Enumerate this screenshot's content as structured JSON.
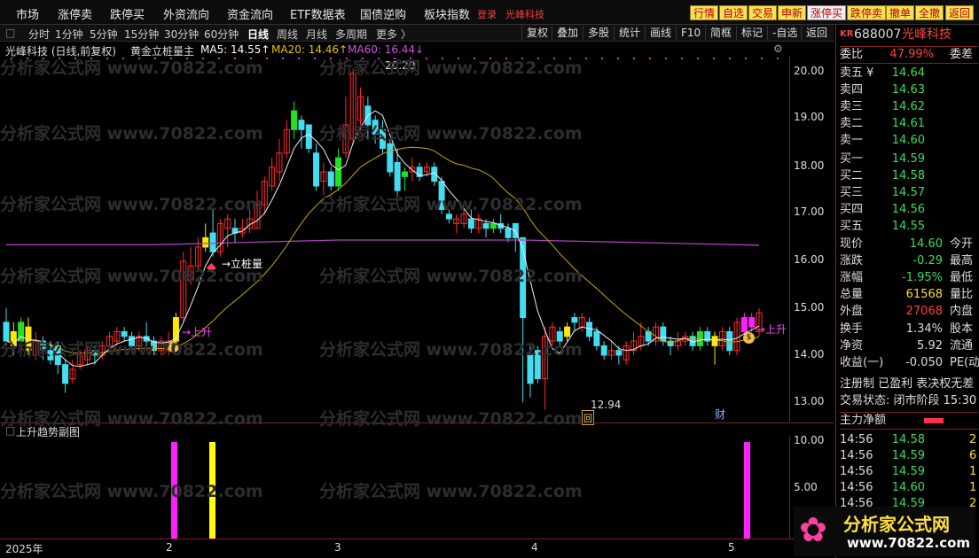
{
  "menu": {
    "items": [
      "市场",
      "涨停卖",
      "跌停买",
      "外资流向",
      "资金流向",
      "ETF数据表",
      "国债逆购",
      "板块指数"
    ],
    "login": "登录",
    "stock": "光峰科技"
  },
  "trade_buttons": [
    "行情",
    "自选",
    "交易",
    "申新",
    "涨停买",
    "跌停卖",
    "撤单",
    "全撤",
    "返回"
  ],
  "periods": [
    "分时",
    "1分钟",
    "5分钟",
    "15分钟",
    "30分钟",
    "60分钟",
    "日线",
    "周线",
    "月线",
    "多周期",
    "更多 〉"
  ],
  "active_period": "日线",
  "tools": [
    "复权",
    "叠加",
    "多股",
    "统计",
    "画线",
    "F10",
    "简框",
    "标记",
    "-自选",
    "返回"
  ],
  "info": {
    "name": "光峰科技 (日线,前复权)",
    "indicator": "黄金立桩量主",
    "ma5": "MA5: 14.55↑",
    "ma20": "MA20: 14.46↑",
    "ma60": "MA60: 16.44↓"
  },
  "annotations": {
    "high": "20.20",
    "low": "12.94",
    "libo": "→立桩量",
    "up1": "→上升",
    "up2": "→上升",
    "cai": "财",
    "hui": "回"
  },
  "y_ticks": [
    "20.00",
    "19.00",
    "18.00",
    "17.00",
    "16.00",
    "15.00",
    "14.00",
    "13.00"
  ],
  "sub": {
    "title": "上升趋势副图",
    "ticks": [
      "10.00",
      "5.00"
    ]
  },
  "dates": {
    "year": "2025年",
    "m2": "2",
    "m3": "3",
    "m4": "4",
    "m5": "5"
  },
  "watermark": "分析家公式网 www.70822.com",
  "panel": {
    "code": "688007",
    "name": "光峰科技",
    "kr": "KR",
    "weibi": {
      "label": "委比",
      "value": "47.99%",
      "extra": "委差"
    },
    "asks": [
      {
        "label": "卖五 ¥",
        "price": "14.64"
      },
      {
        "label": "卖四",
        "price": "14.63"
      },
      {
        "label": "卖三",
        "price": "14.62"
      },
      {
        "label": "卖二",
        "price": "14.61"
      },
      {
        "label": "卖一",
        "price": "14.60"
      }
    ],
    "bids": [
      {
        "label": "买一",
        "price": "14.59"
      },
      {
        "label": "买二",
        "price": "14.58"
      },
      {
        "label": "买三",
        "price": "14.57"
      },
      {
        "label": "买四",
        "price": "14.56"
      },
      {
        "label": "买五",
        "price": "14.55"
      }
    ],
    "stats": [
      {
        "label": "现价",
        "value": "14.60",
        "extra": "今开",
        "color": "#3ddc5c"
      },
      {
        "label": "涨跌",
        "value": "-0.29",
        "extra": "最高",
        "color": "#3ddc5c"
      },
      {
        "label": "涨幅",
        "value": "-1.95%",
        "extra": "最低",
        "color": "#3ddc5c"
      },
      {
        "label": "总量",
        "value": "61568",
        "extra": "量比",
        "color": "#ffdd33"
      },
      {
        "label": "外盘",
        "value": "27068",
        "extra": "内盘",
        "color": "#ff4040"
      },
      {
        "label": "换手",
        "value": "1.34%",
        "extra": "股本",
        "color": "#ddd"
      },
      {
        "label": "净资",
        "value": "5.92",
        "extra": "流通",
        "color": "#ddd"
      },
      {
        "label": "收益(一)",
        "value": "-0.050",
        "extra": "PE(动",
        "color": "#ddd"
      }
    ],
    "reg": "注册制 已盈利 表决权无差",
    "status": "交易状态: 闭市阶段 15:30",
    "mainflow": "主力净额",
    "ticks": [
      {
        "t": "14:56",
        "p": "14.58",
        "v": "2"
      },
      {
        "t": "14:56",
        "p": "14.59",
        "v": "6"
      },
      {
        "t": "14:56",
        "p": "14.59",
        "v": "1"
      },
      {
        "t": "14:56",
        "p": "14.60",
        "v": "1"
      },
      {
        "t": "14:56",
        "p": "14.59",
        "v": "2"
      }
    ]
  },
  "logo": {
    "text": "分析家公式网",
    "url": "www.70822.com"
  },
  "chart_data": {
    "type": "candlestick",
    "ylim": [
      12.8,
      20.3
    ],
    "candles": [
      [
        14.8,
        14.4,
        15.1,
        14.3
      ],
      [
        14.6,
        14.3,
        14.8,
        14.1
      ],
      [
        14.4,
        14.8,
        14.9,
        14.3
      ],
      [
        14.7,
        14.2,
        14.9,
        14.1
      ],
      [
        14.1,
        14.4,
        14.6,
        14.0
      ],
      [
        14.4,
        14.2,
        14.5,
        14.0
      ],
      [
        14.2,
        14.0,
        14.4,
        13.9
      ],
      [
        14.3,
        13.9,
        14.4,
        13.7
      ],
      [
        13.9,
        13.5,
        14.0,
        13.3
      ],
      [
        13.6,
        13.8,
        14.0,
        13.5
      ],
      [
        13.9,
        14.1,
        14.2,
        13.8
      ],
      [
        14.0,
        14.2,
        14.3,
        13.9
      ],
      [
        14.2,
        14.1,
        14.3,
        13.9
      ],
      [
        14.1,
        14.3,
        14.4,
        14.0
      ],
      [
        14.3,
        14.5,
        14.6,
        14.2
      ],
      [
        14.4,
        14.6,
        14.7,
        14.3
      ],
      [
        14.6,
        14.5,
        14.7,
        14.4
      ],
      [
        14.5,
        14.3,
        14.6,
        14.2
      ],
      [
        14.3,
        14.5,
        14.6,
        14.2
      ],
      [
        14.5,
        14.4,
        14.8,
        14.3
      ],
      [
        14.4,
        14.2,
        14.5,
        14.1
      ],
      [
        14.2,
        14.4,
        14.5,
        14.1
      ],
      [
        14.2,
        14.4,
        14.6,
        14.1
      ],
      [
        14.4,
        14.9,
        15.0,
        14.2
      ],
      [
        14.9,
        16.1,
        16.3,
        14.8
      ],
      [
        15.7,
        16.0,
        16.4,
        15.6
      ],
      [
        16.0,
        16.4,
        16.6,
        15.9
      ],
      [
        16.4,
        16.6,
        16.9,
        16.3
      ],
      [
        16.7,
        16.3,
        17.2,
        16.2
      ],
      [
        16.3,
        16.9,
        17.0,
        16.2
      ],
      [
        16.8,
        17.0,
        17.1,
        16.4
      ],
      [
        16.8,
        16.7,
        17.0,
        16.5
      ],
      [
        16.7,
        16.8,
        17.0,
        16.6
      ],
      [
        16.8,
        17.0,
        17.2,
        16.7
      ],
      [
        16.8,
        17.3,
        17.6,
        16.8
      ],
      [
        17.3,
        17.8,
        17.9,
        17.1
      ],
      [
        17.7,
        18.1,
        18.3,
        17.6
      ],
      [
        18.0,
        18.4,
        18.7,
        17.8
      ],
      [
        18.4,
        18.9,
        19.1,
        18.3
      ],
      [
        18.9,
        19.3,
        19.5,
        18.7
      ],
      [
        19.1,
        18.9,
        19.2,
        18.5
      ],
      [
        19.0,
        18.5,
        19.0,
        18.4
      ],
      [
        18.4,
        17.7,
        18.6,
        17.6
      ],
      [
        17.8,
        18.0,
        18.2,
        17.5
      ],
      [
        18.0,
        17.7,
        18.1,
        17.6
      ],
      [
        17.7,
        18.3,
        18.5,
        17.6
      ],
      [
        18.4,
        19.0,
        19.6,
        18.3
      ],
      [
        18.7,
        20.1,
        20.2,
        18.6
      ],
      [
        19.1,
        19.6,
        19.8,
        18.9
      ],
      [
        19.4,
        19.0,
        19.6,
        18.7
      ],
      [
        19.1,
        18.8,
        19.2,
        18.6
      ],
      [
        18.9,
        18.5,
        19.1,
        18.4
      ],
      [
        18.6,
        18.0,
        18.7,
        17.9
      ],
      [
        18.2,
        17.6,
        18.5,
        17.5
      ],
      [
        17.9,
        18.0,
        18.1,
        17.6
      ],
      [
        18.0,
        18.1,
        18.3,
        17.8
      ],
      [
        18.1,
        17.9,
        18.2,
        17.8
      ],
      [
        18.0,
        18.1,
        18.2,
        17.9
      ],
      [
        18.1,
        17.8,
        18.2,
        17.7
      ],
      [
        17.8,
        17.2,
        17.9,
        17.1
      ],
      [
        17.1,
        17.0,
        17.2,
        16.9
      ],
      [
        16.9,
        17.0,
        17.1,
        16.7
      ],
      [
        16.9,
        17.1,
        17.2,
        16.8
      ],
      [
        17.0,
        16.8,
        17.2,
        16.7
      ],
      [
        16.8,
        17.0,
        17.1,
        16.7
      ],
      [
        16.9,
        16.8,
        17.0,
        16.6
      ],
      [
        16.8,
        16.9,
        17.0,
        16.7
      ],
      [
        16.9,
        16.8,
        17.1,
        16.7
      ],
      [
        16.8,
        16.6,
        16.9,
        16.5
      ],
      [
        16.9,
        16.6,
        16.9,
        16.3
      ],
      [
        16.6,
        14.9,
        16.1,
        13.1
      ],
      [
        14.1,
        13.5,
        14.3,
        13.2
      ],
      [
        14.2,
        13.6,
        14.3,
        13.5
      ],
      [
        13.6,
        14.5,
        14.7,
        12.94
      ],
      [
        14.4,
        14.7,
        14.8,
        14.3
      ],
      [
        14.6,
        14.4,
        14.7,
        14.3
      ],
      [
        14.5,
        14.7,
        14.8,
        14.4
      ],
      [
        14.9,
        14.8,
        15.0,
        14.6
      ],
      [
        14.7,
        14.9,
        15.0,
        14.6
      ],
      [
        14.8,
        14.5,
        14.9,
        14.4
      ],
      [
        14.6,
        14.3,
        14.7,
        14.2
      ],
      [
        14.3,
        14.1,
        14.4,
        14.0
      ],
      [
        14.1,
        14.2,
        14.4,
        14.0
      ],
      [
        14.2,
        14.1,
        14.3,
        13.9
      ],
      [
        14.0,
        14.3,
        14.4,
        13.9
      ],
      [
        14.2,
        14.4,
        14.6,
        14.1
      ],
      [
        14.3,
        14.5,
        14.8,
        14.2
      ],
      [
        14.6,
        14.4,
        14.7,
        14.3
      ],
      [
        14.4,
        14.7,
        14.8,
        14.3
      ],
      [
        14.7,
        14.4,
        14.8,
        14.3
      ],
      [
        14.4,
        14.3,
        14.5,
        14.1
      ],
      [
        14.3,
        14.4,
        14.6,
        14.2
      ],
      [
        14.4,
        14.5,
        14.6,
        14.3
      ],
      [
        14.5,
        14.3,
        14.6,
        14.2
      ],
      [
        14.3,
        14.6,
        14.7,
        14.2
      ],
      [
        14.6,
        14.4,
        14.7,
        14.3
      ],
      [
        14.5,
        14.3,
        14.6,
        13.9
      ],
      [
        14.3,
        14.6,
        14.7,
        14.2
      ],
      [
        14.6,
        14.2,
        14.7,
        14.1
      ],
      [
        14.2,
        14.8,
        14.9,
        14.1
      ],
      [
        14.6,
        14.9,
        15.0,
        14.5
      ],
      [
        14.9,
        14.7,
        15.0,
        14.6
      ],
      [
        14.6,
        15.0,
        15.1,
        14.5
      ]
    ],
    "ma60": [
      [
        0,
        16.45
      ],
      [
        20,
        16.45
      ],
      [
        45,
        16.55
      ],
      [
        70,
        16.55
      ],
      [
        102,
        16.44
      ]
    ]
  }
}
